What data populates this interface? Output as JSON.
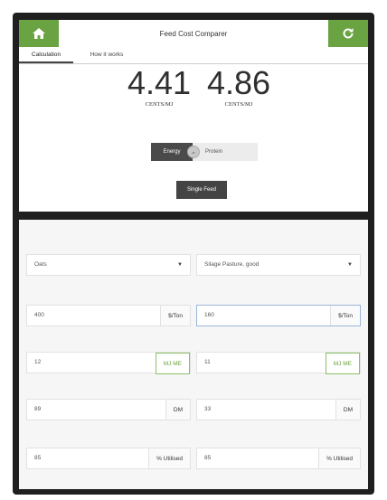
{
  "header": {
    "title": "Feed Cost Comparer",
    "home_icon": "home-icon",
    "refresh_icon": "refresh-icon",
    "accent_color": "#6aa341"
  },
  "tabs": [
    {
      "label": "Calculation",
      "active": true
    },
    {
      "label": "How it works",
      "active": false
    }
  ],
  "results": [
    {
      "value": "4.41",
      "unit": "CENTS/MJ"
    },
    {
      "value": "4.86",
      "unit": "CENTS/MJ"
    }
  ],
  "toggle": {
    "on_label": "Energy",
    "knob_label": "or",
    "off_label": "Protein"
  },
  "single_feed_label": "Single Feed",
  "feeds": [
    {
      "type": "Oats",
      "price": {
        "value": "400",
        "suffix": "$/Ton"
      },
      "energy": {
        "value": "12",
        "suffix": "MJ ME"
      },
      "dm": {
        "value": "89",
        "suffix": "DM"
      },
      "utilised": {
        "value": "85",
        "suffix": "% Utilised"
      }
    },
    {
      "type": "Silage Pasture, good",
      "price": {
        "value": "160",
        "suffix": "$/Ton"
      },
      "energy": {
        "value": "11",
        "suffix": "MJ ME"
      },
      "dm": {
        "value": "33",
        "suffix": "DM"
      },
      "utilised": {
        "value": "85",
        "suffix": "% Utilised"
      }
    }
  ]
}
